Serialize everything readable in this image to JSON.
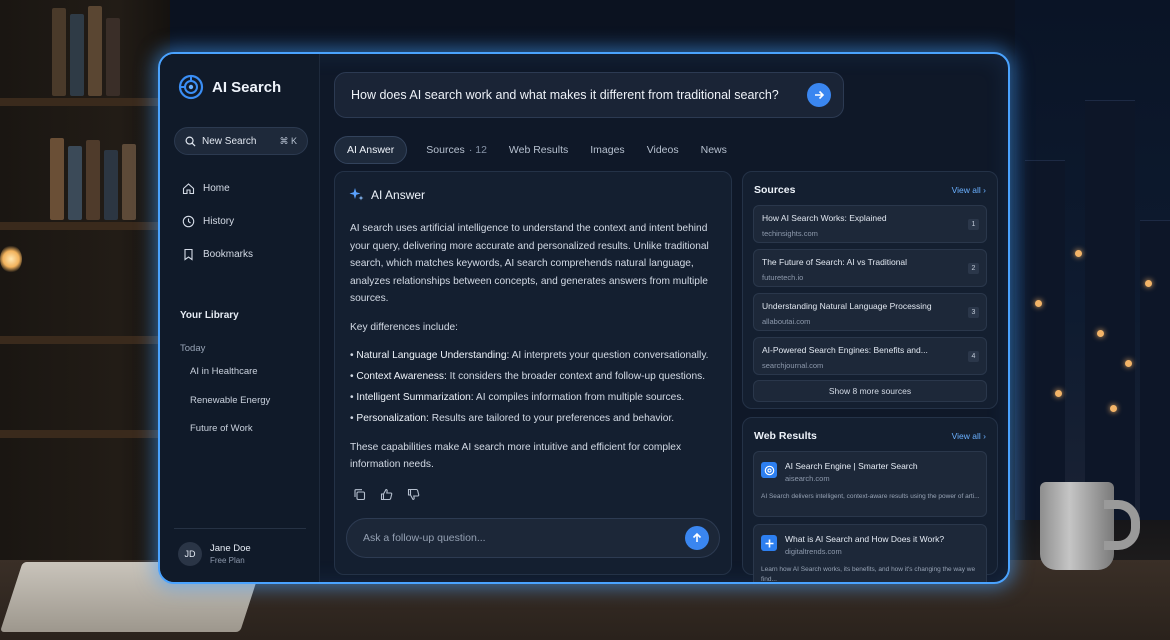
{
  "app": {
    "title": "AI Search"
  },
  "colors": {
    "accent": "#3a86f0",
    "glow": "#4aa3ff",
    "panel": "#141f30",
    "link": "#6ab0ff"
  },
  "sidebar": {
    "new_search_label": "New Search",
    "new_search_shortcut": "⌘ K",
    "nav": [
      {
        "label": "Home",
        "icon": "home-icon"
      },
      {
        "label": "History",
        "icon": "clock-icon"
      },
      {
        "label": "Bookmarks",
        "icon": "bookmark-icon"
      }
    ],
    "library_title": "Your Library",
    "library_group": "Today",
    "library_items": [
      "AI in Healthcare",
      "Renewable Energy",
      "Future of Work"
    ],
    "user": {
      "initials": "JD",
      "name": "Jane Doe",
      "plan": "Free Plan"
    }
  },
  "search": {
    "query": "How does AI search work and what makes it different from traditional search?"
  },
  "tabs": [
    {
      "label": "AI Answer",
      "active": true
    },
    {
      "label": "Sources",
      "count": "· 12"
    },
    {
      "label": "Web Results"
    },
    {
      "label": "Images"
    },
    {
      "label": "Videos"
    },
    {
      "label": "News"
    }
  ],
  "answer": {
    "title": "AI Answer",
    "intro": "AI search uses artificial intelligence to understand the context and intent behind your query, delivering more accurate and personalized results. Unlike traditional search, which matches keywords, AI search comprehends natural language, analyzes relationships between concepts, and generates answers from multiple sources.",
    "differences_heading": "Key differences include:",
    "differences": [
      {
        "term": "Natural Language Understanding:",
        "text": " AI interprets your question conversationally."
      },
      {
        "term": "Context Awareness:",
        "text": " It considers the broader context and follow-up questions."
      },
      {
        "term": "Intelligent Summarization:",
        "text": " AI compiles information from multiple sources."
      },
      {
        "term": "Personalization:",
        "text": " Results are tailored to your preferences and behavior."
      }
    ],
    "conclusion": "These capabilities make AI search more intuitive and efficient for complex information needs.",
    "followup_placeholder": "Ask a follow-up question..."
  },
  "sources": {
    "title": "Sources",
    "view_all": "View all",
    "items": [
      {
        "title": "How AI Search Works: Explained",
        "domain": "techinsights.com",
        "num": "1"
      },
      {
        "title": "The Future of Search: AI vs Traditional",
        "domain": "futuretech.io",
        "num": "2"
      },
      {
        "title": "Understanding Natural Language Processing",
        "domain": "allaboutai.com",
        "num": "3"
      },
      {
        "title": "AI-Powered Search Engines: Benefits and...",
        "domain": "searchjournal.com",
        "num": "4"
      }
    ],
    "show_more": "Show 8 more sources"
  },
  "web_results": {
    "title": "Web Results",
    "view_all": "View all",
    "items": [
      {
        "title": "AI Search Engine | Smarter Search",
        "domain": "aisearch.com",
        "snippet": "AI Search delivers intelligent, context-aware results using the power of arti..."
      },
      {
        "title": "What is AI Search and How Does it Work?",
        "domain": "digitaltrends.com",
        "snippet": "Learn how AI Search works, its benefits, and how it's changing the way we find..."
      }
    ]
  }
}
